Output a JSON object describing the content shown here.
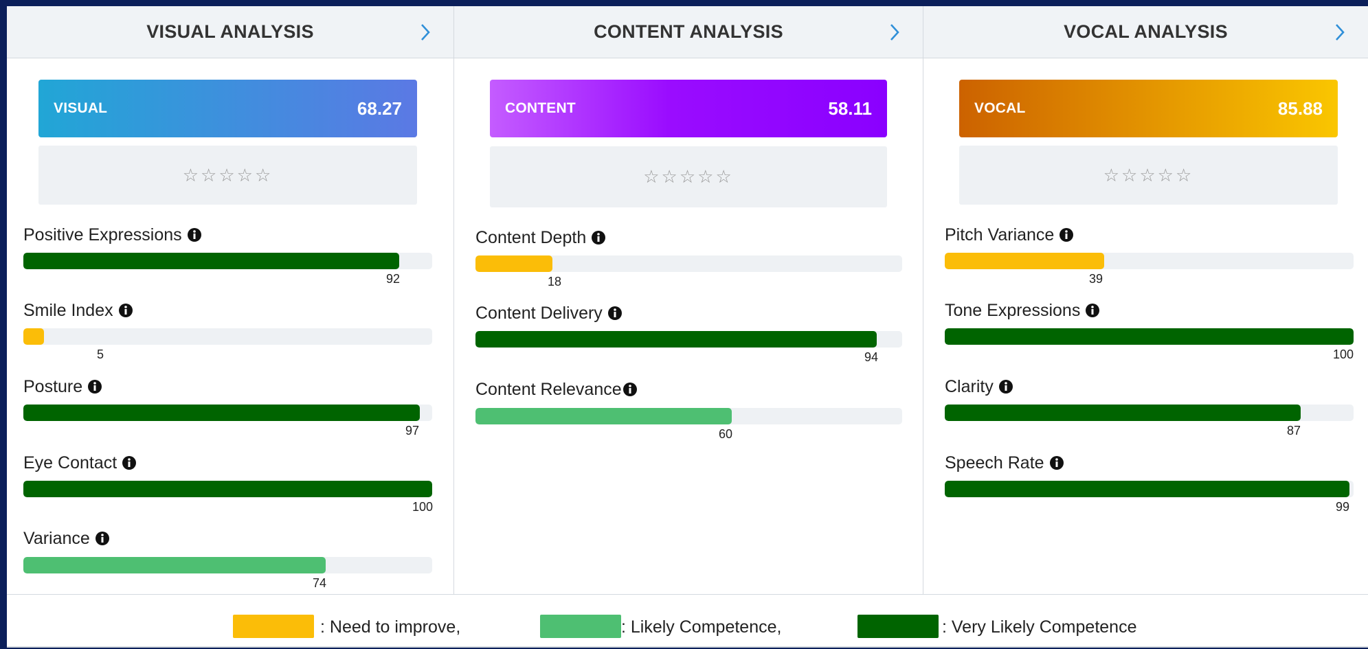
{
  "colors": {
    "need_improve": "#fbbd08",
    "likely": "#4ebf72",
    "very_likely": "#006400",
    "chevron": "#2f8fd8"
  },
  "panels": [
    {
      "title": "VISUAL ANALYSIS",
      "score_label": "VISUAL",
      "score_value": "68.27",
      "stars": "☆☆☆☆☆",
      "metrics": [
        {
          "label": "Positive Expressions",
          "value": 92,
          "display": "92",
          "level": "very_likely"
        },
        {
          "label": "Smile Index",
          "value": 5,
          "display": "5",
          "level": "need_improve"
        },
        {
          "label": "Posture",
          "value": 97,
          "display": "97",
          "level": "very_likely"
        },
        {
          "label": "Eye Contact",
          "value": 100,
          "display": "100",
          "level": "very_likely"
        },
        {
          "label": "Variance",
          "value": 74,
          "display": "74",
          "level": "likely"
        }
      ]
    },
    {
      "title": "CONTENT ANALYSIS",
      "score_label": "CONTENT",
      "score_value": "58.11",
      "stars": "☆☆☆☆☆",
      "metrics": [
        {
          "label": "Content Depth",
          "value": 18,
          "display": "18",
          "level": "need_improve"
        },
        {
          "label": "Content Delivery",
          "value": 94,
          "display": "94",
          "level": "very_likely"
        },
        {
          "label": "Content Relevance",
          "value": 60,
          "display": "60",
          "level": "likely"
        }
      ]
    },
    {
      "title": "VOCAL ANALYSIS",
      "score_label": "VOCAL",
      "score_value": "85.88",
      "stars": "☆☆☆☆☆",
      "metrics": [
        {
          "label": "Pitch Variance",
          "value": 39,
          "display": "39",
          "level": "need_improve"
        },
        {
          "label": "Tone Expressions",
          "value": 100,
          "display": "100",
          "level": "very_likely"
        },
        {
          "label": "Clarity",
          "value": 87,
          "display": "87",
          "level": "very_likely"
        },
        {
          "label": "Speech Rate",
          "value": 99,
          "display": "99",
          "level": "very_likely"
        }
      ]
    }
  ],
  "legend": [
    {
      "key": "need_improve",
      "text": ": Need to improve,"
    },
    {
      "key": "likely",
      "text": ": Likely Competence,"
    },
    {
      "key": "very_likely",
      "text": ": Very Likely Competence"
    }
  ]
}
